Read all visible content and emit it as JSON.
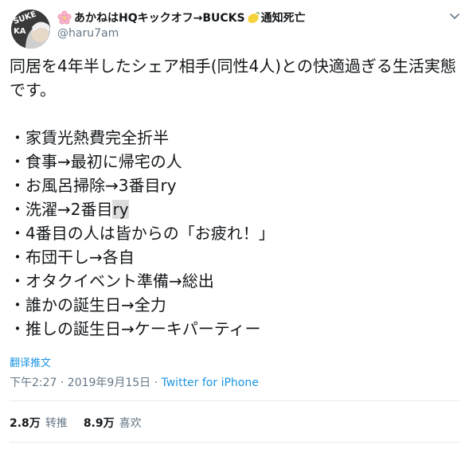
{
  "user": {
    "display_name_part1": "あかねはHQキックオフ→BUCKS",
    "display_name_part2": "通知死亡",
    "handle": "@haru7am",
    "avatar_text": "SUKE KA"
  },
  "tweet": {
    "intro": "同居を4年半したシェア相手(同性4人)との快適過ぎる生活実態です。",
    "items": [
      "・家賃光熱費完全折半",
      "・食事→最初に帰宅の人",
      "・お風呂掃除→3番目ry",
      "・洗濯→2番目",
      "・4番目の人は皆からの「お疲れ！」",
      "・布団干し→各自",
      "・オタクイベント準備→総出",
      "・誰かの誕生日→全力",
      "・推しの誕生日→ケーキパーティー"
    ],
    "item3_highlight": "ry"
  },
  "translate_label": "翻译推文",
  "meta": {
    "timestamp": "下午2:27 · 2019年9月15日 · ",
    "source": "Twitter for iPhone"
  },
  "stats": {
    "retweets_count": "2.8万",
    "retweets_label": "转推",
    "likes_count": "8.9万",
    "likes_label": "喜欢"
  },
  "icons": {
    "caret": "chevron-down-icon",
    "flower": "cherry-blossom-icon",
    "lemon": "lemon-icon"
  }
}
